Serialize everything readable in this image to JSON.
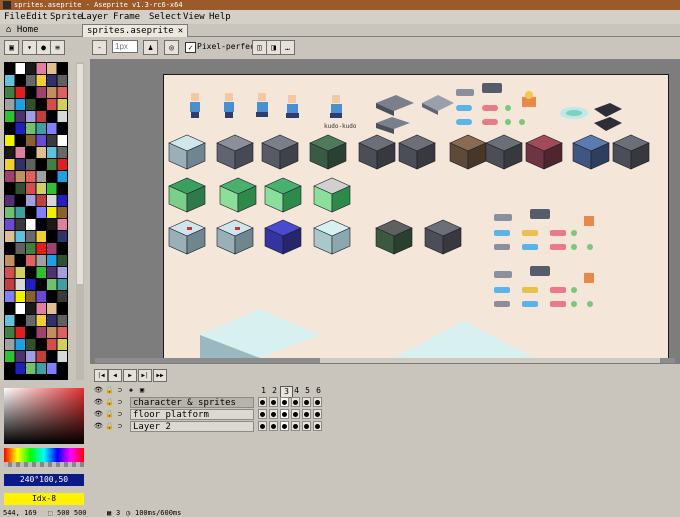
{
  "window": {
    "title": "sprites.aseprite - Aseprite v1.3-rc6-x64"
  },
  "menu": [
    "File",
    "Edit",
    "Sprite",
    "Layer",
    "Frame",
    "Select",
    "View",
    "Help"
  ],
  "tabs": [
    {
      "label": "Home"
    },
    {
      "label": "sprites.aseprite"
    }
  ],
  "toolbar": {
    "brush_size_placeholder": "1px",
    "pixel_perfect_label": "Pixel-perfect",
    "pixel_perfect_checked": true
  },
  "canvas": {
    "sprite_label": "kudo-kudo",
    "background": "#f4e6d8"
  },
  "color": {
    "foreground_label": "240°100,50",
    "background_label": "Idx-8",
    "foreground_hex": "#0a1a88",
    "background_hex": "#fff200"
  },
  "timeline": {
    "frames": [
      "1",
      "2",
      "3",
      "4",
      "5",
      "6"
    ],
    "layers": [
      {
        "name": "character & sprites",
        "selected": true
      },
      {
        "name": "floor platform",
        "selected": false
      },
      {
        "name": "Layer 2",
        "selected": false
      }
    ]
  },
  "status": {
    "position": "544, 169",
    "size": "500 500",
    "frame": "3",
    "duration": "100ms/600ms"
  }
}
